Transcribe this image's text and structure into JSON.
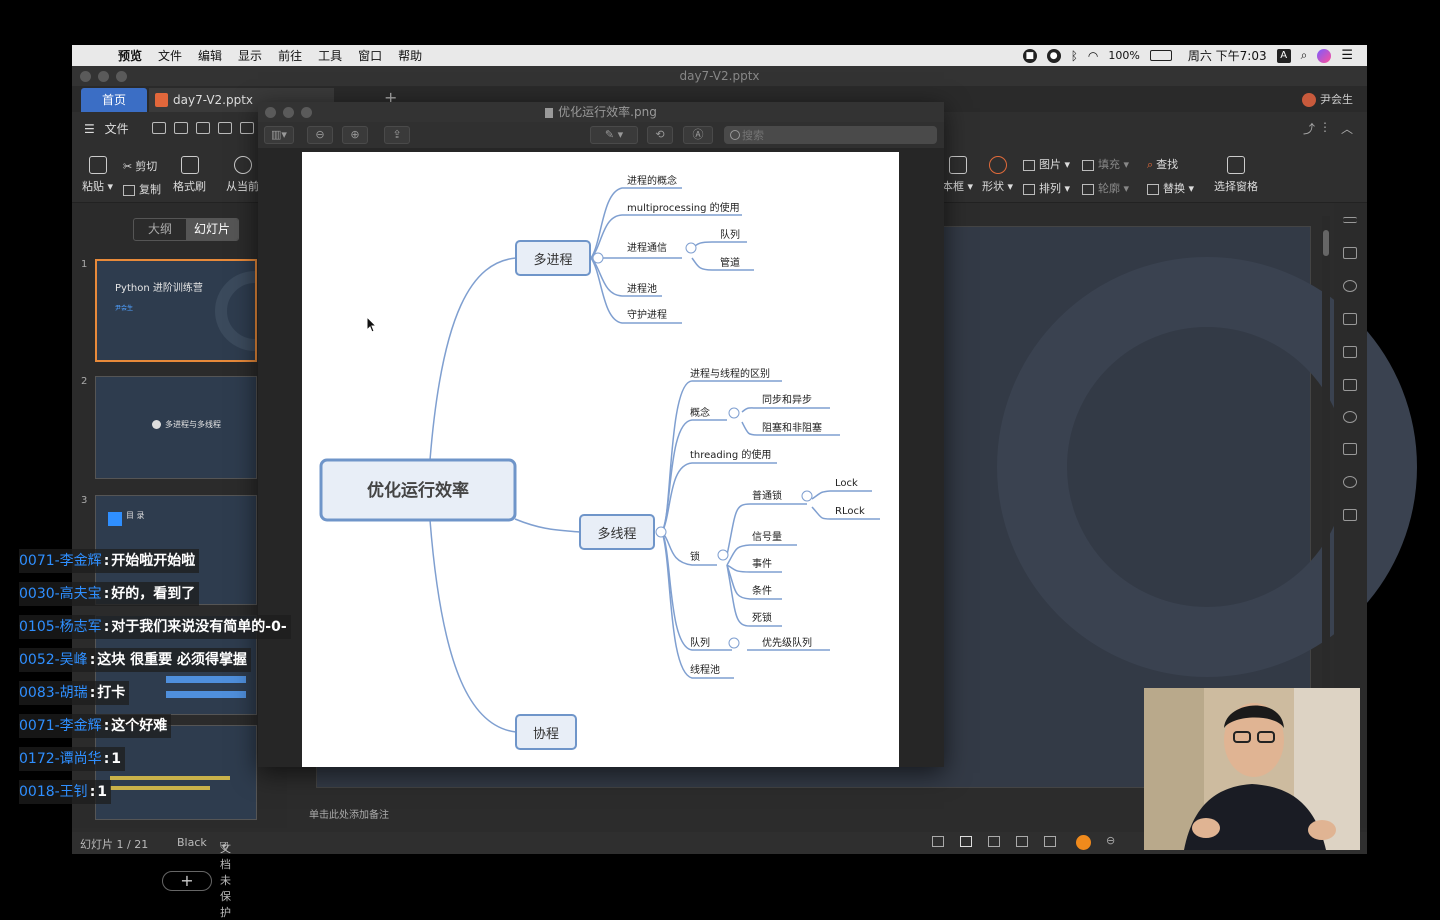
{
  "menubar": {
    "app": "预览",
    "items": [
      "文件",
      "编辑",
      "显示",
      "前往",
      "工具",
      "窗口",
      "帮助"
    ],
    "battery": "100%",
    "clock": "周六 下午7:03",
    "input_method": "A"
  },
  "wps": {
    "window_title": "day7-V2.pptx",
    "home_tab": "首页",
    "file_tab": "day7-V2.pptx",
    "user_name": "尹会生",
    "menu_label": "文件",
    "ribbon": {
      "paste": "粘贴",
      "cut": "剪切",
      "copy": "复制",
      "format_painter": "格式刷",
      "from_current": "从当前",
      "textbox": "本框",
      "shape": "形状",
      "picture": "图片",
      "arrange": "排列",
      "fill": "填充",
      "outline": "轮廓",
      "find": "查找",
      "replace": "替换",
      "selection_pane": "选择窗格"
    },
    "view_switch": {
      "outline": "大纲",
      "slides": "幻灯片"
    },
    "slides": [
      {
        "num": "1",
        "title": "Python 进阶训练营",
        "subtitle": "尹会生"
      },
      {
        "num": "2",
        "title": "多进程与多线程"
      },
      {
        "num": "3",
        "title": "目 录"
      }
    ],
    "notes_placeholder": "单击此处添加备注",
    "status": {
      "slide_count": "幻灯片 1 / 21",
      "theme": "Black",
      "protection": "文档未保护"
    }
  },
  "preview": {
    "title": "优化运行效率.png",
    "search_placeholder": "搜索",
    "mindmap": {
      "root": "优化运行效率",
      "branch_multiprocess": "多进程",
      "mp_items": [
        "进程的概念",
        "multiprocessing 的使用",
        "进程通信",
        "进程池",
        "守护进程"
      ],
      "mp_comm_items": [
        "队列",
        "管道"
      ],
      "branch_multithread": "多线程",
      "mt_diff": "进程与线程的区别",
      "mt_concept": "概念",
      "mt_concept_items": [
        "同步和异步",
        "阻塞和非阻塞"
      ],
      "mt_threading": "threading 的使用",
      "mt_lock": "锁",
      "mt_lock_items": [
        "普通锁",
        "信号量",
        "事件",
        "条件",
        "死锁"
      ],
      "mt_lock_normal_items": [
        "Lock",
        "RLock"
      ],
      "mt_queue": "队列",
      "mt_queue_item": "优先级队列",
      "mt_pool": "线程池",
      "branch_coroutine": "协程"
    }
  },
  "chat": [
    {
      "user": "0071-李金辉",
      "msg": "开始啦开始啦"
    },
    {
      "user": "0030-高夫宝",
      "msg": "好的，看到了"
    },
    {
      "user": "0105-杨志军",
      "msg": "对于我们来说没有简单的-0-"
    },
    {
      "user": "0052-吴峰",
      "msg": "这块 很重要 必须得掌握"
    },
    {
      "user": "0083-胡瑞",
      "msg": "打卡"
    },
    {
      "user": "0071-李金辉",
      "msg": "这个好难"
    },
    {
      "user": "0172-谭尚华",
      "msg": "1"
    },
    {
      "user": "0018-王钊",
      "msg": "1"
    }
  ],
  "colors": {
    "mindmap_node_border": "#6f95c9",
    "mindmap_node_fill": "#e8eef7",
    "mindmap_line": "#7f9fd0",
    "chat_user": "#2f8fff",
    "wps_tab_active": "#3b6ec5"
  }
}
